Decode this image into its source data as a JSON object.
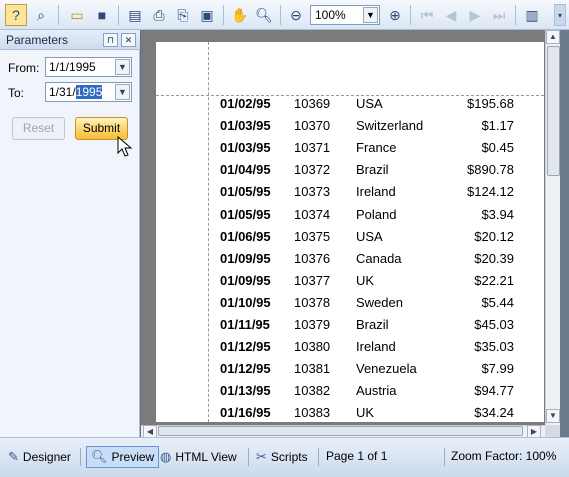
{
  "toolbar": {
    "zoom_value": "100%",
    "icons": [
      "help-icon",
      "find-icon",
      "open-icon",
      "save-icon",
      "page-setup-icon",
      "print-icon",
      "print-direct-icon",
      "export-icon",
      "hand-tool-icon",
      "magnifier-icon",
      "zoom-out-icon",
      "zoom-in-icon",
      "first-page-icon",
      "previous-page-icon",
      "next-page-icon",
      "last-page-icon",
      "multiple-pages-icon"
    ]
  },
  "parameters": {
    "title": "Parameters",
    "from_label": "From:",
    "from_value": "1/1/1995",
    "to_label": "To:",
    "to_value_prefix": "1/31/",
    "to_value_selected": "1995",
    "reset_label": "Reset",
    "submit_label": "Submit"
  },
  "report": {
    "rows": [
      {
        "date": "01/02/95",
        "id": "10369",
        "country": "USA",
        "amount": "$195.68"
      },
      {
        "date": "01/03/95",
        "id": "10370",
        "country": "Switzerland",
        "amount": "$1.17"
      },
      {
        "date": "01/03/95",
        "id": "10371",
        "country": "France",
        "amount": "$0.45"
      },
      {
        "date": "01/04/95",
        "id": "10372",
        "country": "Brazil",
        "amount": "$890.78"
      },
      {
        "date": "01/05/95",
        "id": "10373",
        "country": "Ireland",
        "amount": "$124.12"
      },
      {
        "date": "01/05/95",
        "id": "10374",
        "country": "Poland",
        "amount": "$3.94"
      },
      {
        "date": "01/06/95",
        "id": "10375",
        "country": "USA",
        "amount": "$20.12"
      },
      {
        "date": "01/09/95",
        "id": "10376",
        "country": "Canada",
        "amount": "$20.39"
      },
      {
        "date": "01/09/95",
        "id": "10377",
        "country": "UK",
        "amount": "$22.21"
      },
      {
        "date": "01/10/95",
        "id": "10378",
        "country": "Sweden",
        "amount": "$5.44"
      },
      {
        "date": "01/11/95",
        "id": "10379",
        "country": "Brazil",
        "amount": "$45.03"
      },
      {
        "date": "01/12/95",
        "id": "10380",
        "country": "Ireland",
        "amount": "$35.03"
      },
      {
        "date": "01/12/95",
        "id": "10381",
        "country": "Venezuela",
        "amount": "$7.99"
      },
      {
        "date": "01/13/95",
        "id": "10382",
        "country": "Austria",
        "amount": "$94.77"
      },
      {
        "date": "01/16/95",
        "id": "10383",
        "country": "UK",
        "amount": "$34.24"
      }
    ]
  },
  "statusbar": {
    "tabs": [
      {
        "label": "Designer",
        "icon": "designer-icon",
        "active": false
      },
      {
        "label": "Preview",
        "icon": "preview-icon",
        "active": true
      },
      {
        "label": "HTML View",
        "icon": "html-view-icon",
        "active": false
      },
      {
        "label": "Scripts",
        "icon": "scripts-icon",
        "active": false
      }
    ],
    "page_info": "Page 1 of 1",
    "zoom_factor": "Zoom Factor: 100%"
  }
}
